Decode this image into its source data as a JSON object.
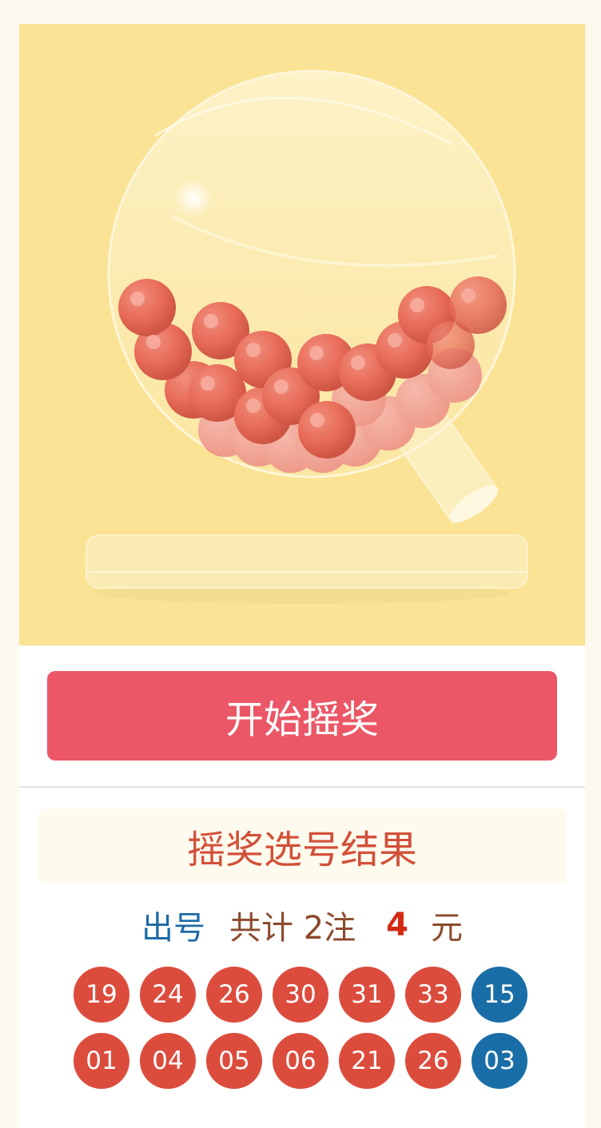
{
  "colors": {
    "page_bg": "#fef9ef",
    "stage_bg": "#fae394",
    "button_bg": "#eb5766",
    "title_text": "#d25039",
    "red_ball": "#dc4c3d",
    "blue_ball": "#1a6ea7"
  },
  "stage": {
    "icon": "lottery-drum-icon"
  },
  "start_button": {
    "label": "开始摇奖"
  },
  "result": {
    "title": "摇奖选号结果",
    "summary": {
      "label": "出号",
      "text": "共计 2注",
      "amount": "4",
      "unit": "元"
    },
    "rows": [
      {
        "red": [
          "19",
          "24",
          "26",
          "30",
          "31",
          "33"
        ],
        "blue": "15"
      },
      {
        "red": [
          "01",
          "04",
          "05",
          "06",
          "21",
          "26"
        ],
        "blue": "03"
      }
    ]
  }
}
